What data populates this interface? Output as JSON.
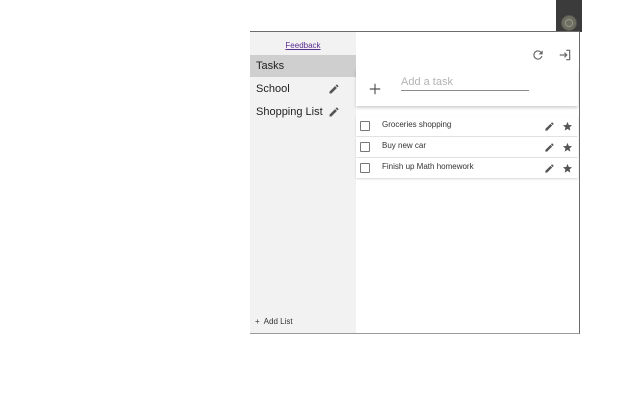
{
  "browser": {
    "extension_icon": "globe-icon"
  },
  "sidebar": {
    "feedback_label": "Feedback",
    "lists": [
      {
        "label": "Tasks",
        "active": true
      },
      {
        "label": "School",
        "active": false,
        "edit_icon": "pencil-icon"
      },
      {
        "label": "Shopping List",
        "active": false,
        "edit_icon": "pencil-icon"
      }
    ],
    "add_list_icon": "+",
    "add_list_label": "Add List"
  },
  "toolbar": {
    "refresh_icon": "refresh-icon",
    "exit_icon": "exit-icon"
  },
  "add_task": {
    "icon": "plus-icon",
    "placeholder": "Add a task",
    "value": ""
  },
  "tasks": [
    {
      "title": "Groceries shopping",
      "completed": false,
      "starred": false
    },
    {
      "title": "Buy new car",
      "completed": false,
      "starred": false
    },
    {
      "title": "Finish up Math homework",
      "completed": false,
      "starred": false
    }
  ],
  "colors": {
    "sidebar_bg": "#f2f2f2",
    "active_item_bg": "#cfcfcf",
    "feedback_link": "#5a2d91",
    "icon_gray": "#666666"
  }
}
